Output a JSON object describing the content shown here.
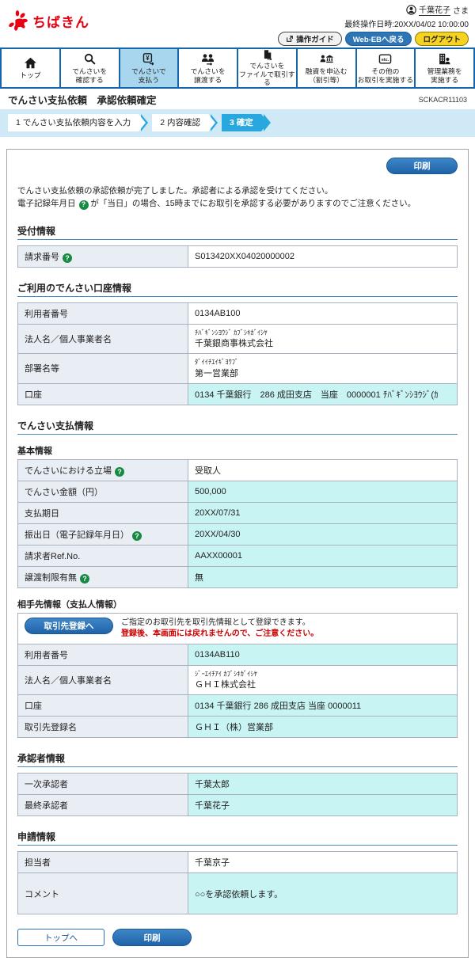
{
  "icons": {
    "help": "?"
  },
  "header": {
    "logo_text": "ちばきん",
    "user_name": "千葉花子",
    "user_suffix": "さま",
    "last_operation": "最終操作日時:20XX/04/02 10:00:00",
    "guide_button": "操作ガイド",
    "web_eb_button": "Web-EBへ戻る",
    "logout_button": "ログアウト"
  },
  "nav": {
    "items": [
      {
        "label": "トップ"
      },
      {
        "label": "でんさいを\n確認する"
      },
      {
        "label": "でんさいで\n支払う"
      },
      {
        "label": "でんさいを\n譲渡する"
      },
      {
        "label": "でんさいを\nファイルで取引する"
      },
      {
        "label": "融資を申込む\n（割引等）"
      },
      {
        "label": "その他の\nお取引を実施する"
      },
      {
        "label": "管理業務を\n実施する"
      }
    ]
  },
  "page": {
    "title": "でんさい支払依頼　承認依頼確定",
    "screen_id": "SCKACR11103"
  },
  "steps": [
    {
      "label": "1 でんさい支払依頼内容を入力"
    },
    {
      "label": "2 内容確認"
    },
    {
      "label": "3 確定"
    }
  ],
  "main": {
    "print_button": "印刷",
    "message_line1": "でんさい支払依頼の承認依頼が完了しました。承認者による承認を受けてください。",
    "message_line2_pre": "電子記録年月日",
    "message_line2_post": "が「当日」の場合、15時までにお取引を承認する必要がありますのでご注意ください。",
    "sections": {
      "reception": {
        "title": "受付情報",
        "rows": [
          {
            "label": "請求番号",
            "value": "S013420XX04020000002"
          }
        ]
      },
      "account": {
        "title": "ご利用のでんさい口座情報",
        "rows": [
          {
            "label": "利用者番号",
            "value": "0134AB100"
          },
          {
            "label": "法人名／個人事業者名",
            "kana": "ﾁﾊﾞｷﾞﾝｼﾖｳｼﾞ ｶﾌﾞｼｷｶﾞｲｼﾔ",
            "value": "千葉銀商事株式会社"
          },
          {
            "label": "部署名等",
            "kana": "ﾀﾞｲｲﾁｴｲｷﾞﾖｳﾌﾞ",
            "value": "第一営業部"
          },
          {
            "label": "口座",
            "value": "0134 千葉銀行　286 成田支店　当座　0000001 ﾁﾊﾞｷﾞﾝｼﾖｳｼﾞ(ｶ"
          }
        ]
      },
      "payment": {
        "title": "でんさい支払情報",
        "basic": {
          "subtitle": "基本情報",
          "rows": [
            {
              "label": "でんさいにおける立場",
              "value": "受取人"
            },
            {
              "label": "でんさい金額（円）",
              "value": "500,000"
            },
            {
              "label": "支払期日",
              "value": "20XX/07/31"
            },
            {
              "label": "振出日（電子記録年月日）",
              "value": "20XX/04/30"
            },
            {
              "label": "請求者Ref.No.",
              "value": "AAXX00001"
            },
            {
              "label": "譲渡制限有無",
              "value": "無"
            }
          ]
        },
        "counterparty": {
          "subtitle": "相手先情報（支払人情報）",
          "register_button": "取引先登録へ",
          "note1": "ご指定のお取引先を取引先情報として登録できます。",
          "note2": "登録後、本画面には戻れませんので、ご注意ください。",
          "rows": [
            {
              "label": "利用者番号",
              "value": "0134AB110"
            },
            {
              "label": "法人名／個人事業者名",
              "kana": "ｼﾞｰｴｲﾁｱｲ ｶﾌﾞｼｷｶﾞｲｼﾔ",
              "value": "ＧＨＩ株式会社"
            },
            {
              "label": "口座",
              "value": "0134 千葉銀行 286 成田支店 当座 0000011"
            },
            {
              "label": "取引先登録名",
              "value": "ＧＨＩ（株）営業部"
            }
          ]
        }
      },
      "approvers": {
        "title": "承認者情報",
        "rows": [
          {
            "label": "一次承認者",
            "value": "千葉太郎"
          },
          {
            "label": "最終承認者",
            "value": "千葉花子"
          }
        ]
      },
      "application": {
        "title": "申請情報",
        "rows": [
          {
            "label": "担当者",
            "value": "千葉京子"
          },
          {
            "label": "コメント",
            "value": "○○を承認依頼します。"
          }
        ]
      }
    },
    "bottom": {
      "top_button": "トップへ",
      "print_button": "印刷"
    }
  }
}
